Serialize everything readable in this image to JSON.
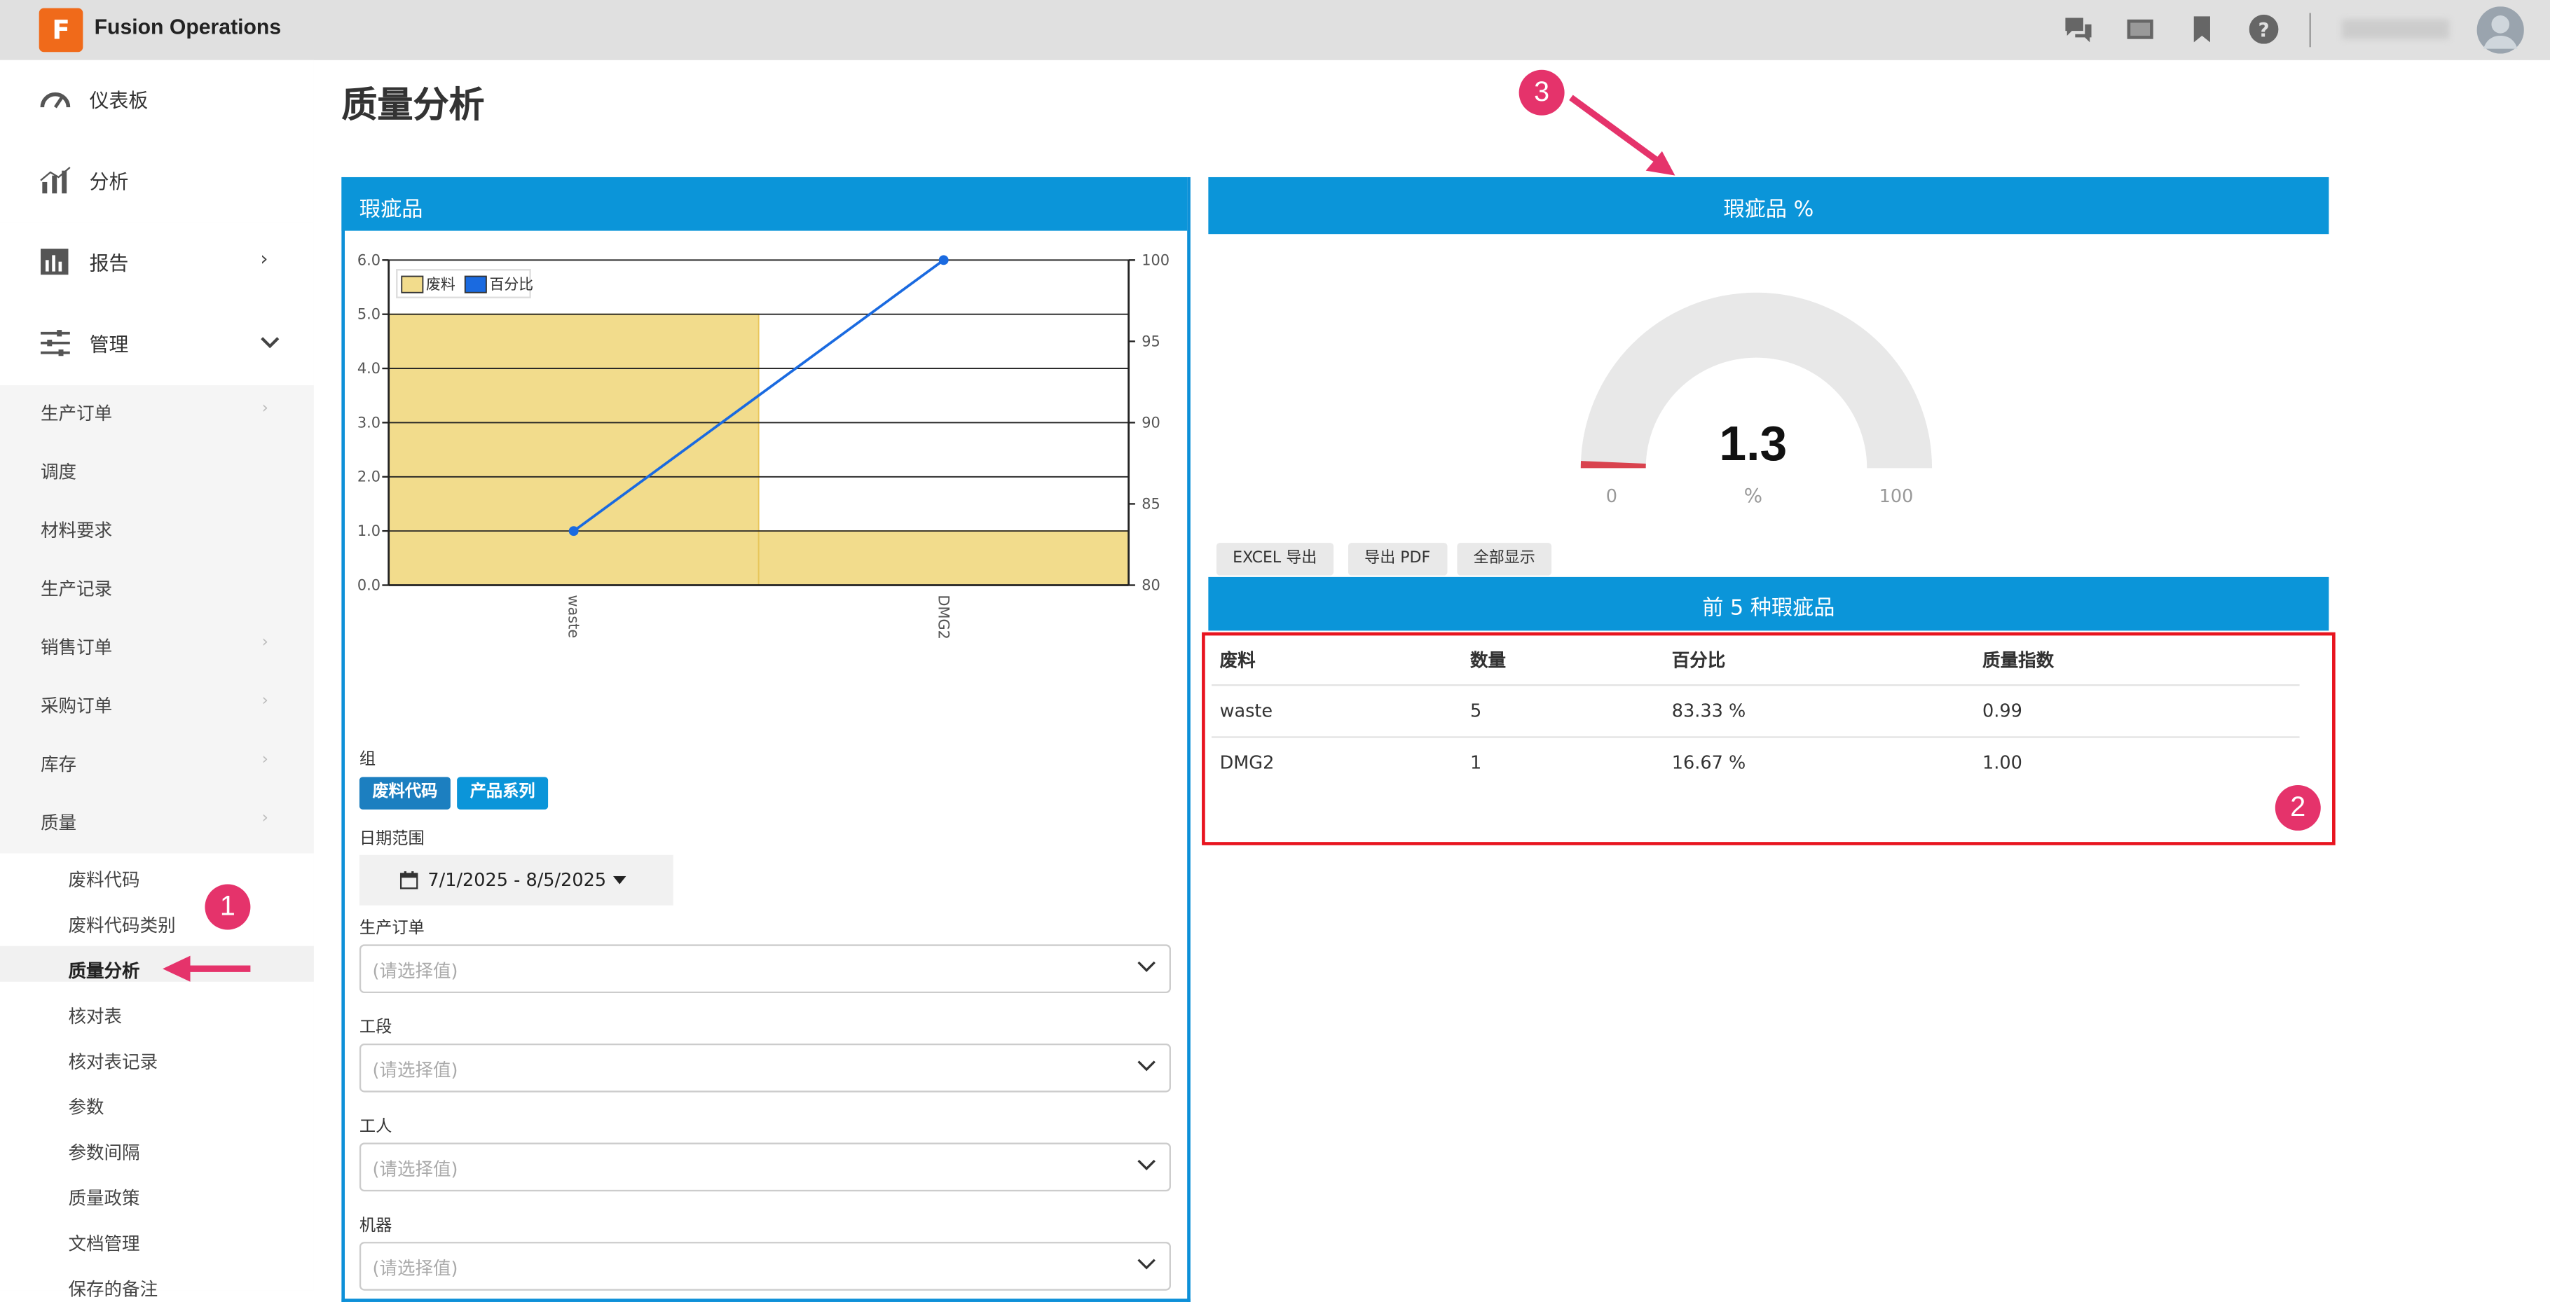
{
  "app": {
    "name": "Fusion Operations",
    "logo_letter": "F"
  },
  "topbar": {
    "icons": [
      "chat-icon",
      "screen-icon",
      "bookmark-icon",
      "help-icon"
    ]
  },
  "sidebar": {
    "main": [
      {
        "label": "仪表板",
        "icon": "dashboard-icon"
      },
      {
        "label": "分析",
        "icon": "analytics-icon"
      },
      {
        "label": "报告",
        "icon": "report-icon",
        "chevron": "›"
      },
      {
        "label": "管理",
        "icon": "sliders-icon",
        "chevron": "⌄"
      }
    ],
    "sub": [
      {
        "label": "生产订单",
        "chevron": "›"
      },
      {
        "label": "调度"
      },
      {
        "label": "材料要求"
      },
      {
        "label": "生产记录"
      },
      {
        "label": "销售订单",
        "chevron": "›"
      },
      {
        "label": "采购订单",
        "chevron": "›"
      },
      {
        "label": "库存",
        "chevron": "›"
      },
      {
        "label": "质量",
        "chevron": "›"
      }
    ],
    "quality": [
      "废料代码",
      "废料代码类别",
      "质量分析",
      "核对表",
      "核对表记录",
      "参数",
      "参数间隔",
      "质量政策",
      "文档管理",
      "保存的备注"
    ],
    "active_quality": "质量分析"
  },
  "page": {
    "title": "质量分析"
  },
  "left_panel": {
    "title": "瑕疵品",
    "group_label": "组",
    "group_tags": [
      "废料代码",
      "产品系列"
    ],
    "date_label": "日期范围",
    "date_value": "7/1/2025 - 8/5/2025",
    "filters": [
      {
        "label": "生产订单",
        "placeholder": "(请选择值)"
      },
      {
        "label": "工段",
        "placeholder": "(请选择值)"
      },
      {
        "label": "工人",
        "placeholder": "(请选择值)"
      },
      {
        "label": "机器",
        "placeholder": "(请选择值)"
      }
    ]
  },
  "chart_data": {
    "type": "bar",
    "categories": [
      "waste",
      "DMG2"
    ],
    "series": [
      {
        "name": "废料",
        "type": "bar",
        "axis": "left",
        "values": [
          5,
          1
        ],
        "color": "#f2dc8c"
      },
      {
        "name": "百分比",
        "type": "line",
        "axis": "right",
        "values": [
          83.33,
          100
        ],
        "color": "#1a6ae0"
      }
    ],
    "ylim": [
      0,
      6
    ],
    "y2lim": [
      80,
      100
    ],
    "yticks": [
      "0.0",
      "1.0",
      "2.0",
      "3.0",
      "4.0",
      "5.0",
      "6.0"
    ],
    "y2ticks": [
      "80",
      "85",
      "90",
      "95",
      "100"
    ],
    "legend": "top-left"
  },
  "right_panel": {
    "title": "瑕疵品 %",
    "gauge": {
      "value": "1.3",
      "unit": "%",
      "min": "0",
      "max": "100",
      "fraction": 0.013
    },
    "buttons": [
      "EXCEL 导出",
      "导出 PDF",
      "全部显示"
    ],
    "table_title": "前 5 种瑕疵品",
    "columns": [
      "废料",
      "数量",
      "百分比",
      "质量指数"
    ],
    "rows": [
      [
        "waste",
        "5",
        "83.33 %",
        "0.99"
      ],
      [
        "DMG2",
        "1",
        "16.67 %",
        "1.00"
      ]
    ]
  },
  "markers": [
    "1",
    "2",
    "3"
  ],
  "colors": {
    "accent": "#0b95d9",
    "annotation": "#e5336b",
    "highlight": "#e8141f"
  }
}
